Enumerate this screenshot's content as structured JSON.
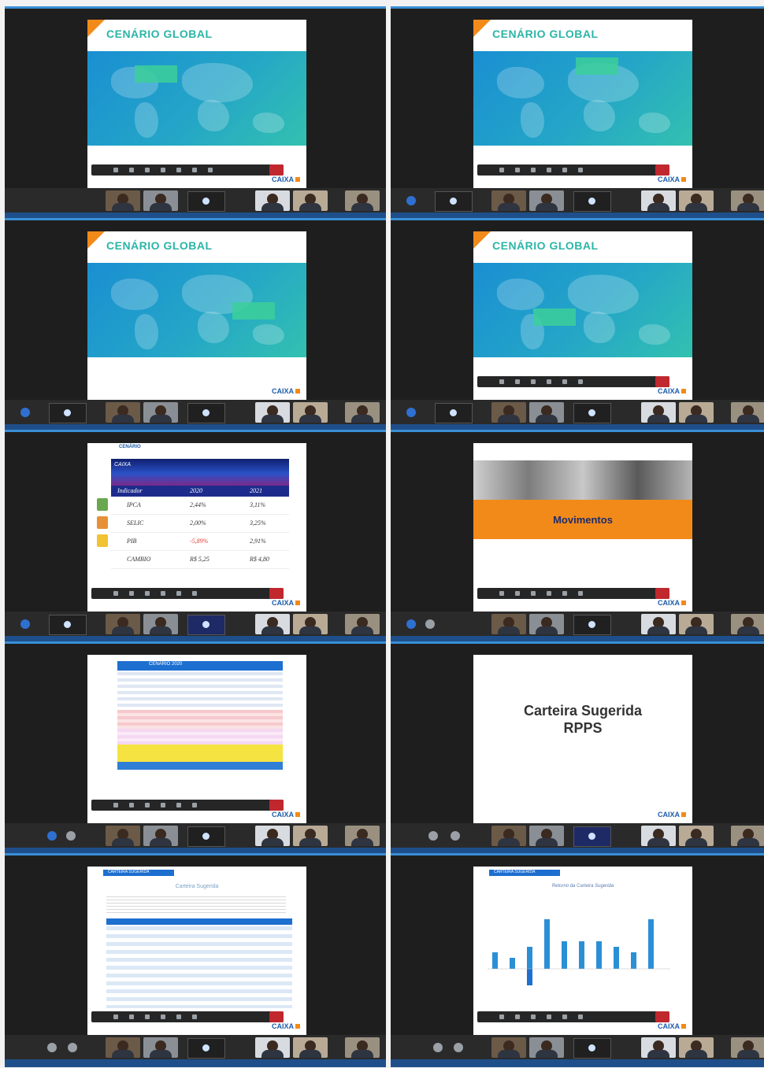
{
  "panels": {
    "cenario_title": "CENÁRIO GLOBAL",
    "logo": "CAIXA",
    "indicadores": {
      "section": "CENÁRIO",
      "brand": "CAIXA",
      "columns": [
        "Indicador",
        "2020",
        "2021"
      ],
      "rows": [
        {
          "name": "IPCA",
          "v2020": "2,44%",
          "v2021": "3,11%"
        },
        {
          "name": "SELIC",
          "v2020": "2,00%",
          "v2021": "3,25%"
        },
        {
          "name": "PIB",
          "v2020": "-5,89%",
          "v2021": "2,91%"
        },
        {
          "name": "CAMBIO",
          "v2020": "R$ 5,25",
          "v2021": "R$ 4,80"
        }
      ]
    },
    "movimentos": "Movimentos",
    "renda_fixa_title": "CENÁRIO 2020",
    "carteira": {
      "title_line1": "Carteira Sugerida",
      "title_line2": "RPPS"
    },
    "carteira_table": {
      "bar_label": "CARTEIRA SUGERIDA",
      "name": "Carteira Sugerida"
    },
    "chart": {
      "bar_label": "CARTEIRA SUGERIDA",
      "title": "Retorno da Carteira Sugerida"
    }
  },
  "chart_data": {
    "type": "bar",
    "values": [
      3,
      2,
      4,
      9,
      5,
      5,
      5,
      4,
      3,
      9
    ],
    "negatives": [
      0,
      0,
      3,
      0,
      0,
      0,
      0,
      0,
      0,
      0
    ],
    "ylim": [
      -4,
      10
    ]
  },
  "colors": {
    "accent_orange": "#f28a1a",
    "caixa_blue": "#1c5ca8",
    "teal_title": "#2bb5a6",
    "call_end": "#c0282e"
  }
}
